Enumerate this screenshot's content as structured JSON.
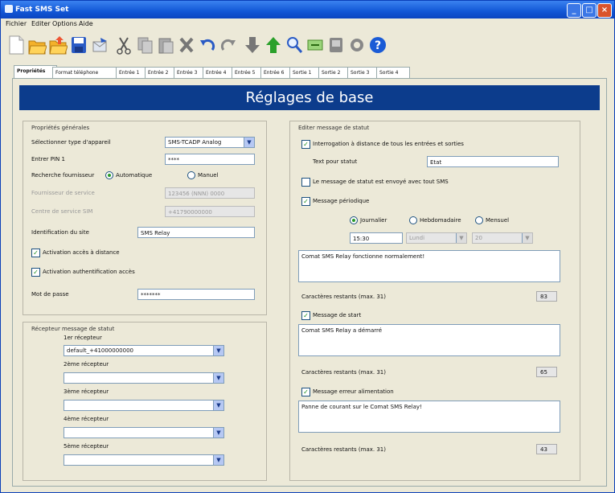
{
  "window": {
    "title": "Fast SMS Set"
  },
  "menu": [
    "Fichier",
    "Editer",
    "Options",
    "Aide"
  ],
  "toolbar_icons": [
    "new-icon",
    "open-icon",
    "open-folder-icon",
    "save-icon",
    "send-icon",
    "cut-icon",
    "copy-icon",
    "paste-icon",
    "delete-icon",
    "undo-icon",
    "redo-icon",
    "arrow-down-icon",
    "arrow-up-icon",
    "search-icon",
    "export-icon",
    "device-icon",
    "refresh-icon",
    "help-icon"
  ],
  "tabs": [
    "Propriétés",
    "Format téléphone",
    "Entrée 1",
    "Entrée 2",
    "Entrée 3",
    "Entrée 4",
    "Entrée 5",
    "Entrée 6",
    "Sortie 1",
    "Sortie 2",
    "Sortie 3",
    "Sortie 4"
  ],
  "header": "Réglages de base",
  "general": {
    "title": "Propriétés générales",
    "device_type_label": "Sélectionner type d'appareil",
    "device_type_value": "SMS-TCADP Analog",
    "pin_label": "Entrer PIN 1",
    "pin_value": "****",
    "provider_label": "Recherche fournisseur",
    "provider_auto": "Automatique",
    "provider_manual": "Manuel",
    "provider_number_label": "Fournisseur de service",
    "provider_number_value": "123456 (NNN) 0000",
    "sim_label": "Centre de service SIM",
    "sim_value": "+41790000000",
    "site_label": "Identification du site",
    "site_value": "SMS Relay",
    "remote_access_label": "Activation accès à distance",
    "auth_label": "Activation authentification accès",
    "password_label": "Mot de passe",
    "password_value": "*******"
  },
  "receivers": {
    "title": "Récepteur message de statut",
    "r1_label": "1er récepteur",
    "r1_value": "default_+41000000000",
    "r2_label": "2ème récepteur",
    "r3_label": "3ème récepteur",
    "r4_label": "4ème récepteur",
    "r5_label": "5ème récepteur"
  },
  "status": {
    "title": "Editer message de statut",
    "interrogation_label": "Interrogation à distance de tous les entrées et sorties",
    "text_label": "Text pour statut",
    "text_value": "Etat",
    "every_sms_label": "Le message de statut est envoyé avec tout SMS",
    "periodic_label": "Message périodique",
    "daily": "Journalier",
    "weekly": "Hebdomadaire",
    "monthly": "Mensuel",
    "time_value": "15:30",
    "day_value": "Lundi",
    "date_value": "20",
    "periodic_message": "Comat SMS Relay fonctionne normalement!",
    "chars_label": "Caractères restants (max. 31)",
    "chars_periodic": "83",
    "start_label": "Message de start",
    "start_message": "Comat SMS Relay a démarré",
    "chars_start_label": "Caractères restants (max. 31)",
    "chars_start": "65",
    "power_label": "Message erreur alimentation",
    "power_message": "Panne de courant sur le Comat SMS Relay!",
    "chars_power_label": "Caractères restants (max. 31)",
    "chars_power": "43"
  },
  "colors": {
    "title_bar": "#1257d6",
    "header_band": "#0c3c8c",
    "check_green": "#1a8a1a"
  }
}
